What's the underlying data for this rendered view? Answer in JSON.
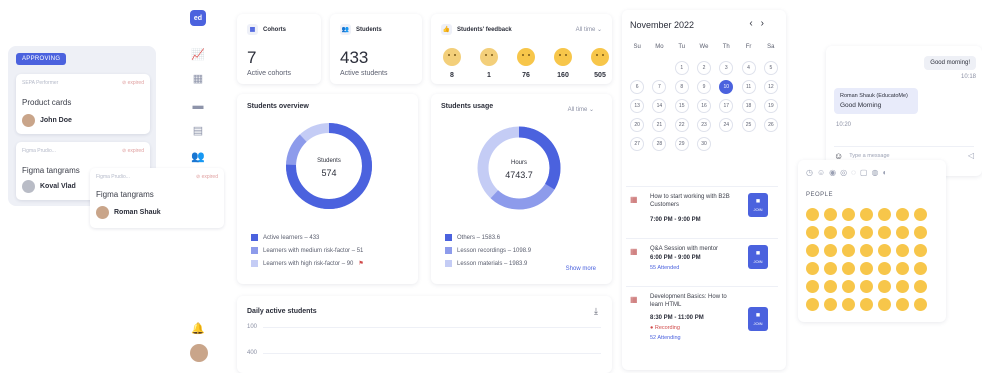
{
  "kanban": {
    "badge": "APPROVING",
    "cards": [
      {
        "tag": "SEPA Performer",
        "expired": "⊘ expired",
        "title": "Product cards",
        "user": "John Doe"
      },
      {
        "tag": "Figma Prudio...",
        "expired": "⊘ expired",
        "title": "Figma tangrams",
        "user": "Koval Vlad"
      }
    ],
    "floating": {
      "tag": "Figma Prudio...",
      "expired": "⊘ expired",
      "title": "Figma tangrams",
      "user": "Roman Shauk"
    }
  },
  "stats": {
    "cohorts": {
      "label": "Cohorts",
      "value": "7",
      "sub": "Active cohorts"
    },
    "students": {
      "label": "Students",
      "value": "433",
      "sub": "Active students"
    }
  },
  "feedback": {
    "label": "Students' feedback",
    "range": "All time ⌄",
    "counts": [
      "8",
      "1",
      "76",
      "160",
      "505"
    ]
  },
  "overview": {
    "title": "Students overview",
    "center_label": "Students",
    "center_value": "574",
    "legend": [
      "Active learners – 433",
      "Learners with medium risk-factor – 51",
      "Learners with high risk-factor – 90"
    ],
    "colors": [
      "#4b62de",
      "#8d9beb",
      "#c4ccf5"
    ]
  },
  "usage": {
    "title": "Students usage",
    "range": "All time ⌄",
    "center_label": "Hours",
    "center_value": "4743.7",
    "legend": [
      "Others – 1583.6",
      "Lesson recordings – 1098.9",
      "Lesson materials – 1983.9"
    ],
    "show_more": "Show more",
    "colors": [
      "#4b62de",
      "#8d9beb",
      "#c4ccf5"
    ]
  },
  "daily": {
    "title": "Daily active students",
    "y_ticks": [
      "100",
      "400"
    ]
  },
  "calendar": {
    "month": "November 2022",
    "prev": "‹",
    "next": "›",
    "weekdays": [
      "Su",
      "Mo",
      "Tu",
      "We",
      "Th",
      "Fr",
      "Sa"
    ],
    "days": [
      "",
      "",
      "1",
      "2",
      "3",
      "4",
      "5",
      "6",
      "7",
      "8",
      "9",
      "10",
      "11",
      "12",
      "13",
      "14",
      "15",
      "16",
      "17",
      "18",
      "19",
      "20",
      "21",
      "22",
      "23",
      "24",
      "25",
      "26",
      "27",
      "28",
      "29",
      "30",
      "",
      "",
      ""
    ],
    "today": "10",
    "events": [
      {
        "title": "How to start working with B2B Customers",
        "time": "7:00 PM - 9:00 PM",
        "sub": "",
        "rec": "",
        "join": "JOIN"
      },
      {
        "title": "Q&A Session with mentor",
        "time": "6:00 PM - 9:00 PM",
        "sub": "55 Attended",
        "rec": "",
        "join": "JOIN"
      },
      {
        "title": "Development Basics: How to learn HTML",
        "time": "8:30 PM - 11:00 PM",
        "sub": "52 Attending",
        "rec": "● Recording",
        "join": "JOIN"
      }
    ]
  },
  "chat": {
    "out_msg": "Good morning!",
    "out_time": "10:18",
    "in_sender": "Roman Shauk (EducatoMe)",
    "in_msg": "Good Morning",
    "in_time": "10:20",
    "placeholder": "Type a message",
    "send": "◁"
  },
  "emoji_picker": {
    "title": "PEOPLE"
  }
}
